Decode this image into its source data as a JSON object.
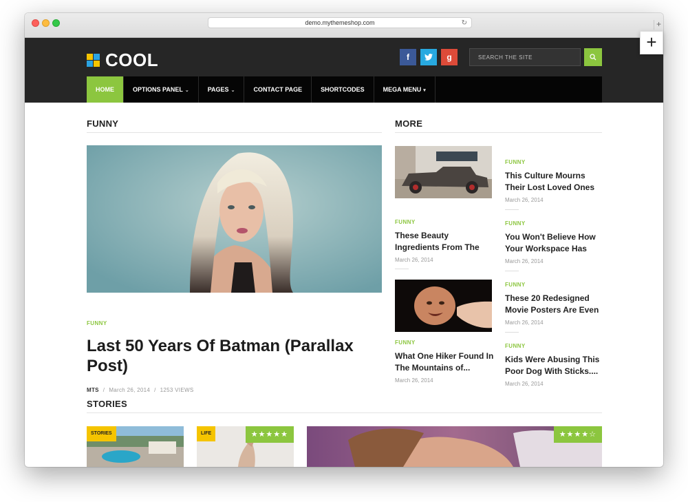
{
  "browser": {
    "url": "demo.mythemeshop.com"
  },
  "site": {
    "logo_text": "COOL",
    "search_placeholder": "SEARCH THE SITE",
    "social": {
      "facebook": "f",
      "twitter": "t",
      "google": "g"
    }
  },
  "nav": {
    "items": [
      {
        "label": "HOME",
        "caret": ""
      },
      {
        "label": "OPTIONS PANEL",
        "caret": "⌄"
      },
      {
        "label": "PAGES",
        "caret": "⌄"
      },
      {
        "label": "CONTACT PAGE",
        "caret": ""
      },
      {
        "label": "SHORTCODES",
        "caret": ""
      },
      {
        "label": "MEGA MENU",
        "caret": "▾"
      }
    ]
  },
  "funny": {
    "heading": "FUNNY",
    "category": "FUNNY",
    "title": "Last 50 Years Of Batman (Parallax Post)",
    "author": "MTS",
    "sep": "/",
    "date": "March 26, 2014",
    "views": "1253 VIEWS"
  },
  "more": {
    "heading": "MORE",
    "left": [
      {
        "category": "FUNNY",
        "title": "These Beauty Ingredients From The",
        "date": "March 26, 2014"
      },
      {
        "category": "FUNNY",
        "title": "What One Hiker Found In The Mountains of...",
        "date": "March 26, 2014"
      }
    ],
    "right": [
      {
        "category": "FUNNY",
        "title": "This Culture Mourns Their Lost Loved Ones",
        "date": "March 26, 2014"
      },
      {
        "category": "FUNNY",
        "title": "You Won't Believe How Your Workspace Has",
        "date": "March 26, 2014"
      },
      {
        "category": "FUNNY",
        "title": "These 20 Redesigned Movie Posters Are Even",
        "date": "March 26, 2014"
      },
      {
        "category": "FUNNY",
        "title": "Kids Were Abusing This Poor Dog With Sticks....",
        "date": "March 26, 2014"
      }
    ]
  },
  "stories": {
    "heading": "STORIES",
    "cards": [
      {
        "badge": "STORIES",
        "stars": ""
      },
      {
        "badge": "LIFE",
        "stars": "★★★★★"
      },
      {
        "badge": "",
        "stars": "★★★★☆"
      }
    ]
  },
  "colors": {
    "accent": "#8cc63f",
    "badge": "#f5c400",
    "header_bg": "#262626",
    "nav_bg": "#050505"
  }
}
